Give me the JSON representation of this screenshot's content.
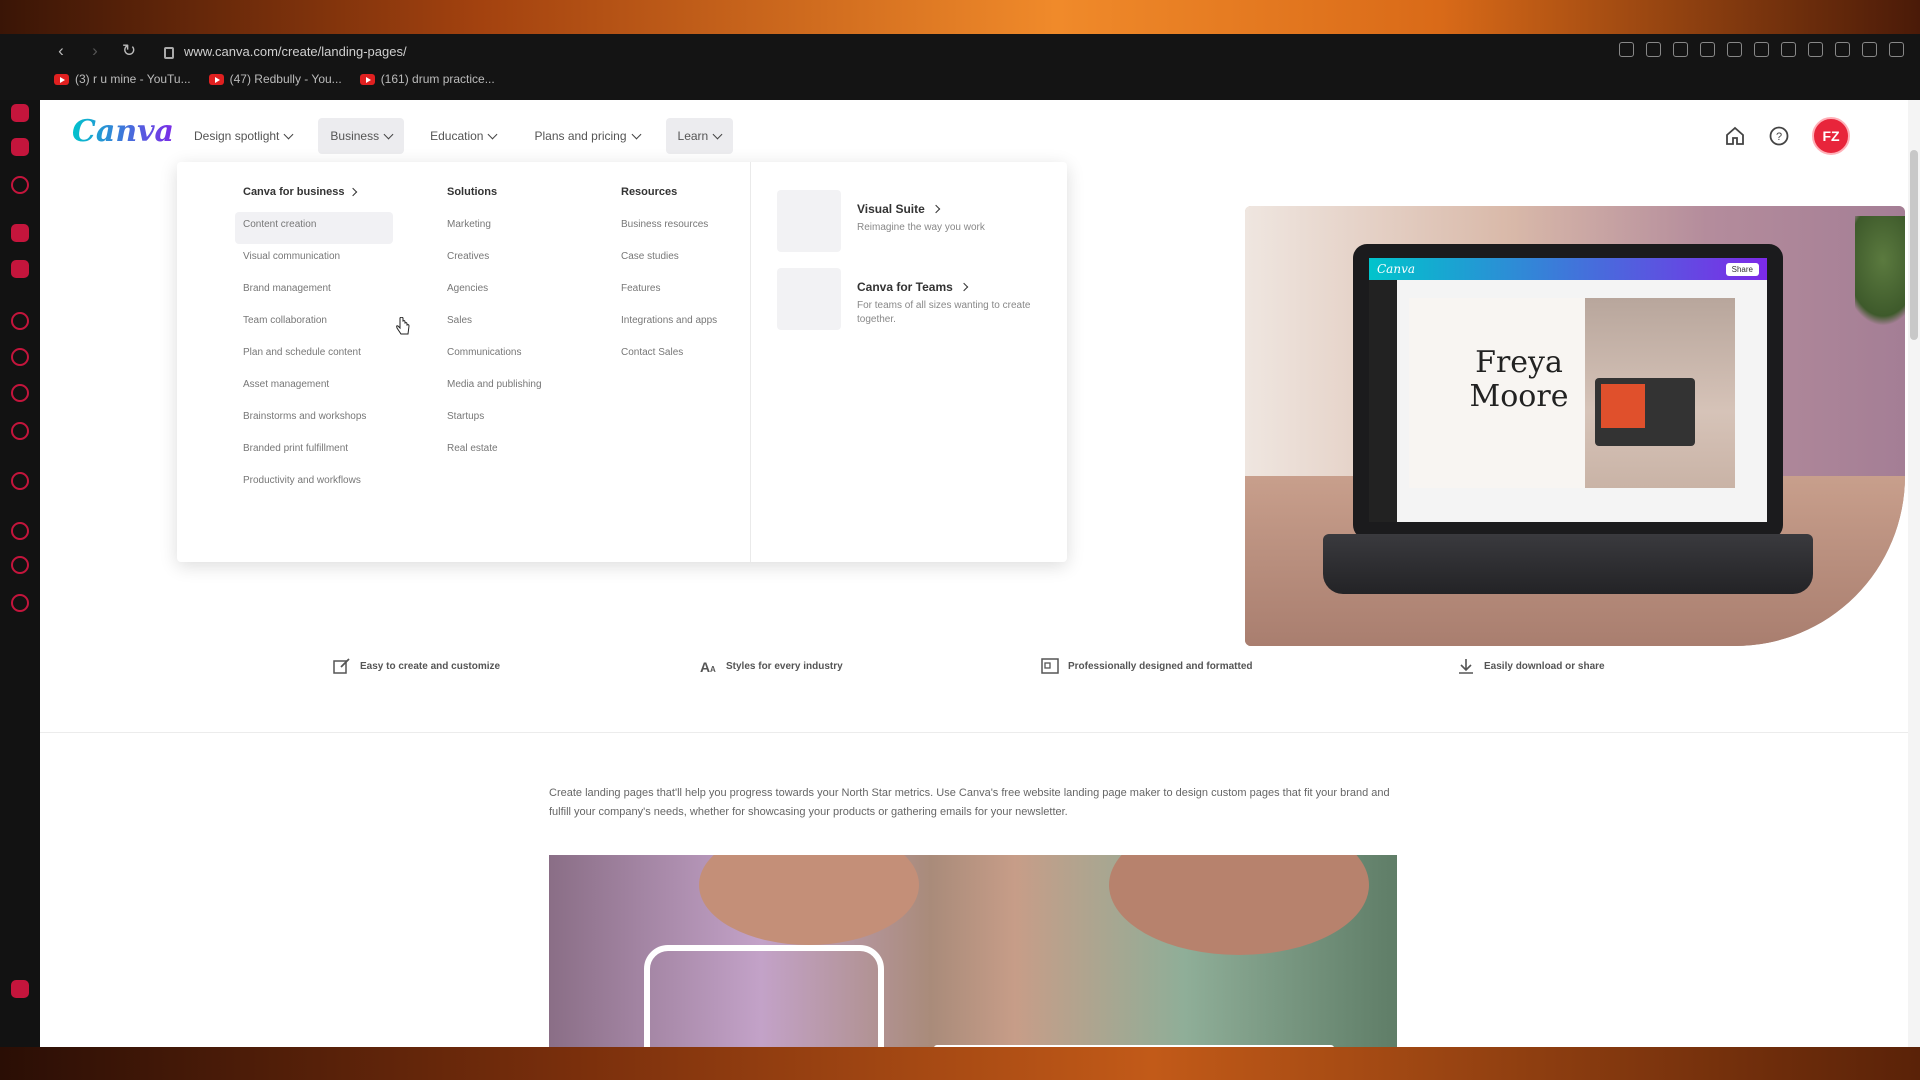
{
  "browser": {
    "url": "www.canva.com/create/landing-pages/",
    "bookmarks": [
      {
        "label": "(3) r u mine - YouTu..."
      },
      {
        "label": "(47) Redbully - You..."
      },
      {
        "label": "(161) drum practice..."
      }
    ]
  },
  "nav": {
    "logo": "Canva",
    "items": [
      {
        "label": "Design spotlight"
      },
      {
        "label": "Business"
      },
      {
        "label": "Education"
      },
      {
        "label": "Plans and pricing"
      },
      {
        "label": "Learn"
      }
    ],
    "avatar_initials": "FZ"
  },
  "dropdown": {
    "business": {
      "title": "Canva for business",
      "items": [
        "Content creation",
        "Visual communication",
        "Brand management",
        "Team collaboration",
        "Plan and schedule content",
        "Asset management",
        "Brainstorms and workshops",
        "Branded print fulfillment",
        "Productivity and workflows"
      ]
    },
    "solutions": {
      "title": "Solutions",
      "items": [
        "Marketing",
        "Creatives",
        "Agencies",
        "Sales",
        "Communications",
        "Media and publishing",
        "Startups",
        "Real estate"
      ]
    },
    "resources": {
      "title": "Resources",
      "items": [
        "Business resources",
        "Case studies",
        "Features",
        "Integrations and apps",
        "Contact Sales"
      ]
    },
    "features": [
      {
        "title": "Visual Suite",
        "desc": "Reimagine the way you work"
      },
      {
        "title": "Canva for Teams",
        "desc": "For teams of all sizes wanting to create together."
      }
    ]
  },
  "hero": {
    "screen_brand": "Canva",
    "screen_share": "Share",
    "doc_name": "Freya Moore"
  },
  "features_row": [
    {
      "label": "Easy to create and customize",
      "icon": "edit-icon"
    },
    {
      "label": "Styles for every industry",
      "icon": "text-style-icon"
    },
    {
      "label": "Professionally designed and formatted",
      "icon": "layout-icon"
    },
    {
      "label": "Easily download or share",
      "icon": "download-icon"
    }
  ],
  "intro": "Create landing pages that'll help you progress towards your North Star metrics. Use Canva's free website landing page maker to design custom pages that fit your brand and fulfill your company's needs, whether for showcasing your products or gathering emails for your newsletter.",
  "colors": {
    "brand_gradient_start": "#00c4cc",
    "brand_gradient_end": "#7d2ae8",
    "avatar": "#e8253b",
    "dock_accent": "#c4153c"
  }
}
